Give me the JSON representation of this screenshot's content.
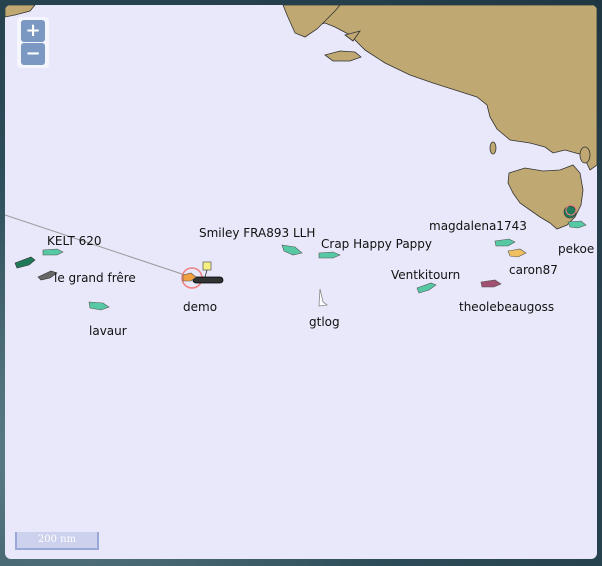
{
  "controls": {
    "zoom_in": "+",
    "zoom_out": "−"
  },
  "scale_bar": {
    "label": "200 nm"
  },
  "colors": {
    "land": "#bfa872",
    "sea": "#e8e8fa",
    "track": "#999999"
  },
  "boats": [
    {
      "name": "KELT 620",
      "color": "#56c8a4"
    },
    {
      "name": "le grand frêre",
      "color": "#666666"
    },
    {
      "name": "lavaur",
      "color": "#56c8a4"
    },
    {
      "name": "demo",
      "color": "#f0a040"
    },
    {
      "name": "Smiley FRA893 LLH",
      "color": "#56c8a4"
    },
    {
      "name": "Crap Happy Pappy",
      "color": "#56c8a4"
    },
    {
      "name": "gtlog",
      "color": "#ffffff"
    },
    {
      "name": "Ventkitourn",
      "color": "#56c8a4"
    },
    {
      "name": "magdalena1743",
      "color": "#56c8a4"
    },
    {
      "name": "caron87",
      "color": "#f0c060"
    },
    {
      "name": "theolebeaugoss",
      "color": "#a05070"
    },
    {
      "name": "pekoe",
      "color": "#56c8a4"
    }
  ],
  "unlabeled_boat_color": "#1f7a5a"
}
